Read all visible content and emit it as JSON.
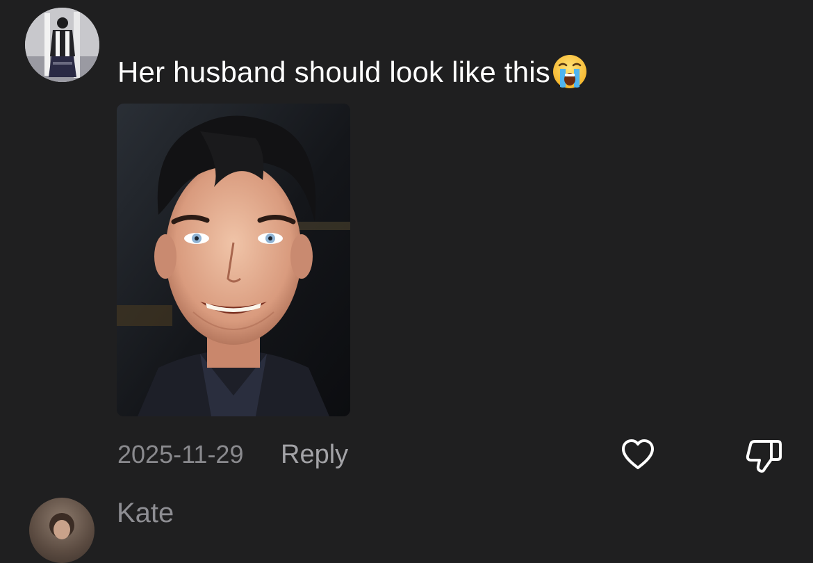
{
  "comment": {
    "text": "Her husband should look like this",
    "emoji": "loudly-crying-face-emoji",
    "timestamp": "2025-11-29",
    "reply_label": "Reply",
    "like_icon": "heart-icon",
    "dislike_icon": "thumbs-down-icon"
  },
  "next_comment": {
    "username": "Kate"
  },
  "colors": {
    "background": "#1f1f20",
    "primary_text": "#ffffff",
    "secondary_text": "#8a8a8e"
  }
}
